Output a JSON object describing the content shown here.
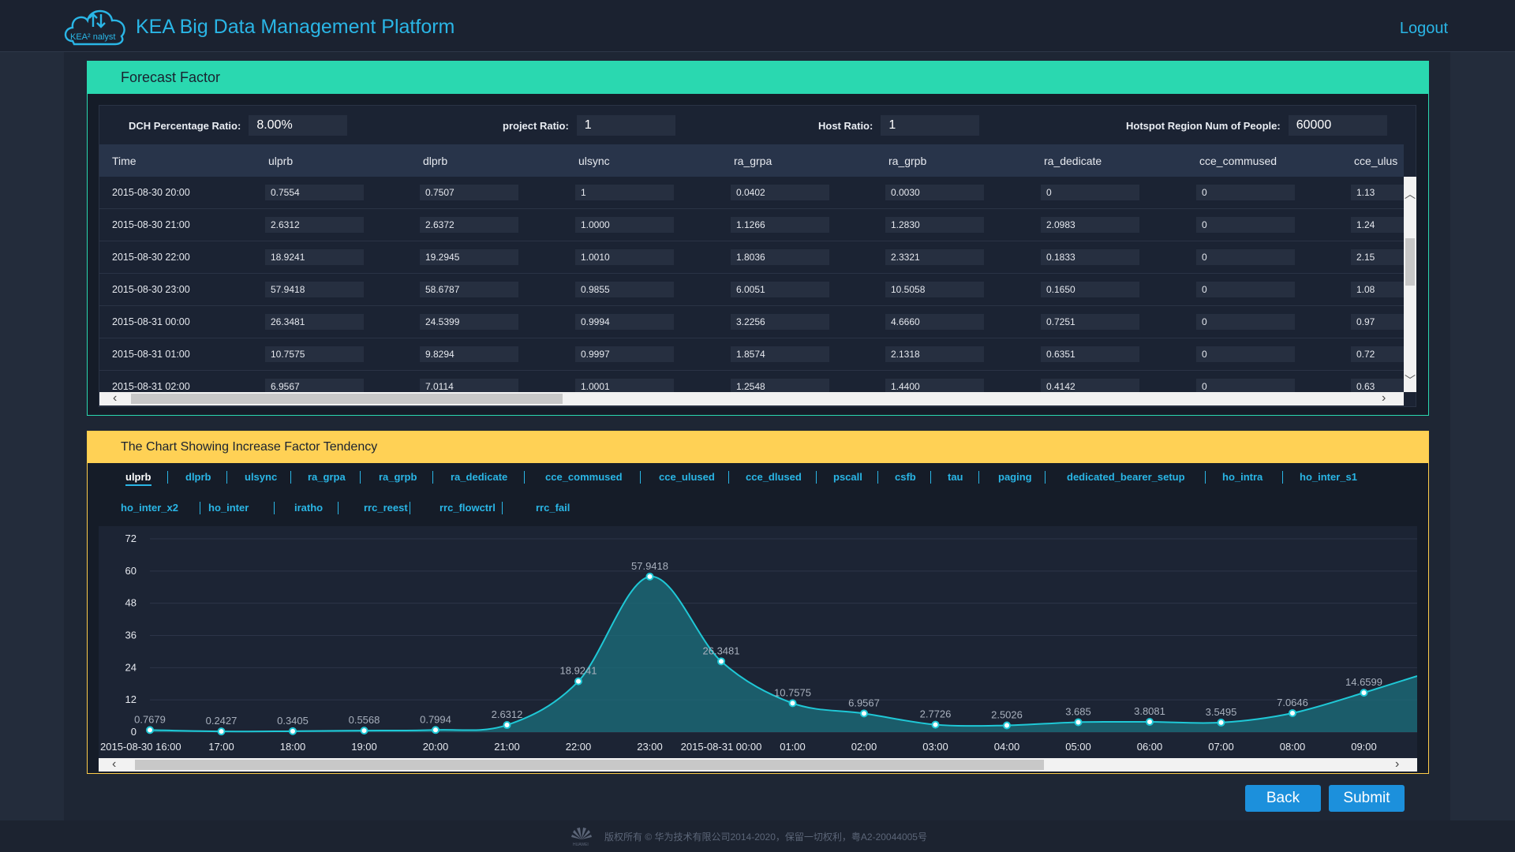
{
  "header": {
    "title": "KEA Big Data Management Platform",
    "logo_text": "KEA² nalyst",
    "logout": "Logout"
  },
  "forecast": {
    "title": "Forecast Factor",
    "ratios": [
      {
        "label": "DCH Percentage Ratio:",
        "value": "8.00%"
      },
      {
        "label": "project Ratio:",
        "value": "1"
      },
      {
        "label": "Host Ratio:",
        "value": "1"
      },
      {
        "label": "Hotspot Region Num of People:",
        "value": "60000"
      }
    ],
    "columns": [
      "Time",
      "ulprb",
      "dlprb",
      "ulsync",
      "ra_grpa",
      "ra_grpb",
      "ra_dedicate",
      "cce_commused",
      "cce_ulus"
    ],
    "rows": [
      [
        "2015-08-30 20:00",
        "0.7554",
        "0.7507",
        "1",
        "0.0402",
        "0.0030",
        "0",
        "0",
        "1.13"
      ],
      [
        "2015-08-30 21:00",
        "2.6312",
        "2.6372",
        "1.0000",
        "1.1266",
        "1.2830",
        "2.0983",
        "0",
        "1.24"
      ],
      [
        "2015-08-30 22:00",
        "18.9241",
        "19.2945",
        "1.0010",
        "1.8036",
        "2.3321",
        "0.1833",
        "0",
        "2.15"
      ],
      [
        "2015-08-30 23:00",
        "57.9418",
        "58.6787",
        "0.9855",
        "6.0051",
        "10.5058",
        "0.1650",
        "0",
        "1.08"
      ],
      [
        "2015-08-31 00:00",
        "26.3481",
        "24.5399",
        "0.9994",
        "3.2256",
        "4.6660",
        "0.7251",
        "0",
        "0.97"
      ],
      [
        "2015-08-31 01:00",
        "10.7575",
        "9.8294",
        "0.9997",
        "1.8574",
        "2.1318",
        "0.6351",
        "0",
        "0.72"
      ],
      [
        "2015-08-31 02:00",
        "6.9567",
        "7.0114",
        "1.0001",
        "1.2548",
        "1.4400",
        "0.4142",
        "0",
        "0.63"
      ]
    ]
  },
  "tendency": {
    "title": "The Chart Showing Increase Factor Tendency",
    "tabs_row1": [
      "ulprb",
      "dlprb",
      "ulsync",
      "ra_grpa",
      "ra_grpb",
      "ra_dedicate",
      "cce_commused",
      "cce_ulused",
      "cce_dlused",
      "pscall",
      "csfb",
      "tau",
      "paging",
      "dedicated_bearer_setup",
      "ho_intra",
      "ho_inter_s1"
    ],
    "tabs_row2": [
      "ho_inter_x2",
      "ho_inter",
      "iratho",
      "rrc_reest",
      "rrc_flowctrl",
      "rrc_fail"
    ],
    "active_tab": "ulprb"
  },
  "chart_data": {
    "type": "area",
    "x": [
      "2015-08-30 16:00",
      "17:00",
      "18:00",
      "19:00",
      "20:00",
      "21:00",
      "22:00",
      "23:00",
      "2015-08-31 00:00",
      "01:00",
      "02:00",
      "03:00",
      "04:00",
      "05:00",
      "06:00",
      "07:00",
      "08:00",
      "09:00"
    ],
    "series": [
      {
        "values": [
          0.7679,
          0.2427,
          0.3405,
          0.5568,
          0.7994,
          2.6312,
          18.9241,
          57.9418,
          26.3481,
          10.7575,
          6.9567,
          2.7726,
          2.5026,
          3.685,
          3.8081,
          3.5495,
          7.0646,
          14.6599
        ]
      }
    ],
    "data_labels": [
      "0.7679",
      "0.2427",
      "0.3405",
      "0.5568",
      "0.7994",
      "2.6312",
      "18.9241",
      "57.9418",
      "26.3481",
      "10.7575",
      "6.9567",
      "2.7726",
      "2.5026",
      "3.685",
      "3.8081",
      "3.5495",
      "7.0646",
      "14.6599"
    ],
    "yticks": [
      0,
      12,
      24,
      36,
      48,
      60,
      72
    ],
    "ylim": [
      0,
      72
    ],
    "colors": {
      "line": "#1fc8d6",
      "fill": "#1b6f7c"
    }
  },
  "buttons": {
    "back": "Back",
    "submit": "Submit"
  },
  "footer": {
    "text": "版权所有 © 华为技术有限公司2014-2020，保留一切权利，粤A2-20044005号",
    "logo_text": "HUAWEI"
  }
}
